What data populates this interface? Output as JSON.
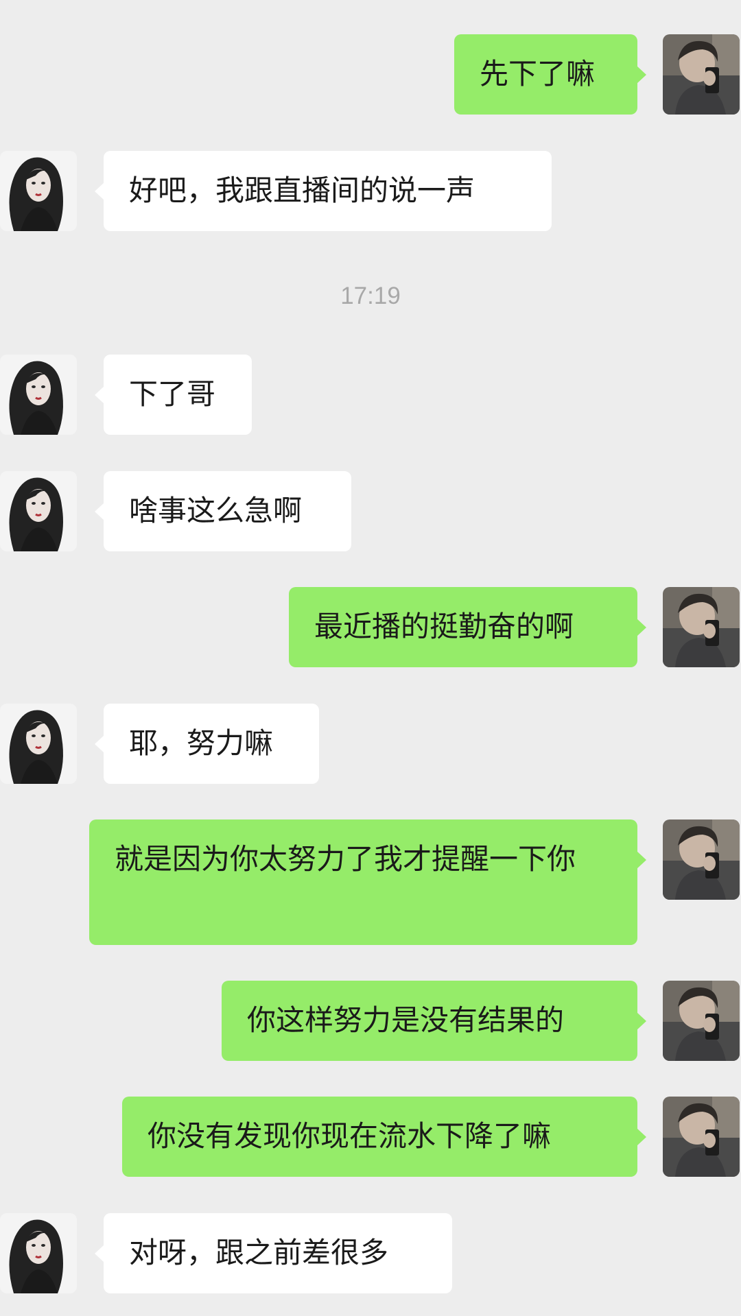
{
  "timestamp": "17:19",
  "avatars": {
    "self": "male-avatar-photo",
    "contact": "female-avatar-illustration"
  },
  "colors": {
    "background": "#ededed",
    "outgoing_bubble": "#95ec69",
    "incoming_bubble": "#ffffff",
    "timestamp_text": "#a8a8a8"
  },
  "messages": [
    {
      "sender": "self",
      "text": "先下了嘛"
    },
    {
      "sender": "contact",
      "text": "好吧，我跟直播间的说一声"
    },
    {
      "sender": "contact",
      "text": "下了哥"
    },
    {
      "sender": "contact",
      "text": "啥事这么急啊"
    },
    {
      "sender": "self",
      "text": "最近播的挺勤奋的啊"
    },
    {
      "sender": "contact",
      "text": "耶，努力嘛"
    },
    {
      "sender": "self",
      "text": "就是因为你太努力了我才提醒一下你"
    },
    {
      "sender": "self",
      "text": "你这样努力是没有结果的"
    },
    {
      "sender": "self",
      "text": "你没有发现你现在流水下降了嘛"
    },
    {
      "sender": "contact",
      "text": "对呀，跟之前差很多"
    }
  ]
}
